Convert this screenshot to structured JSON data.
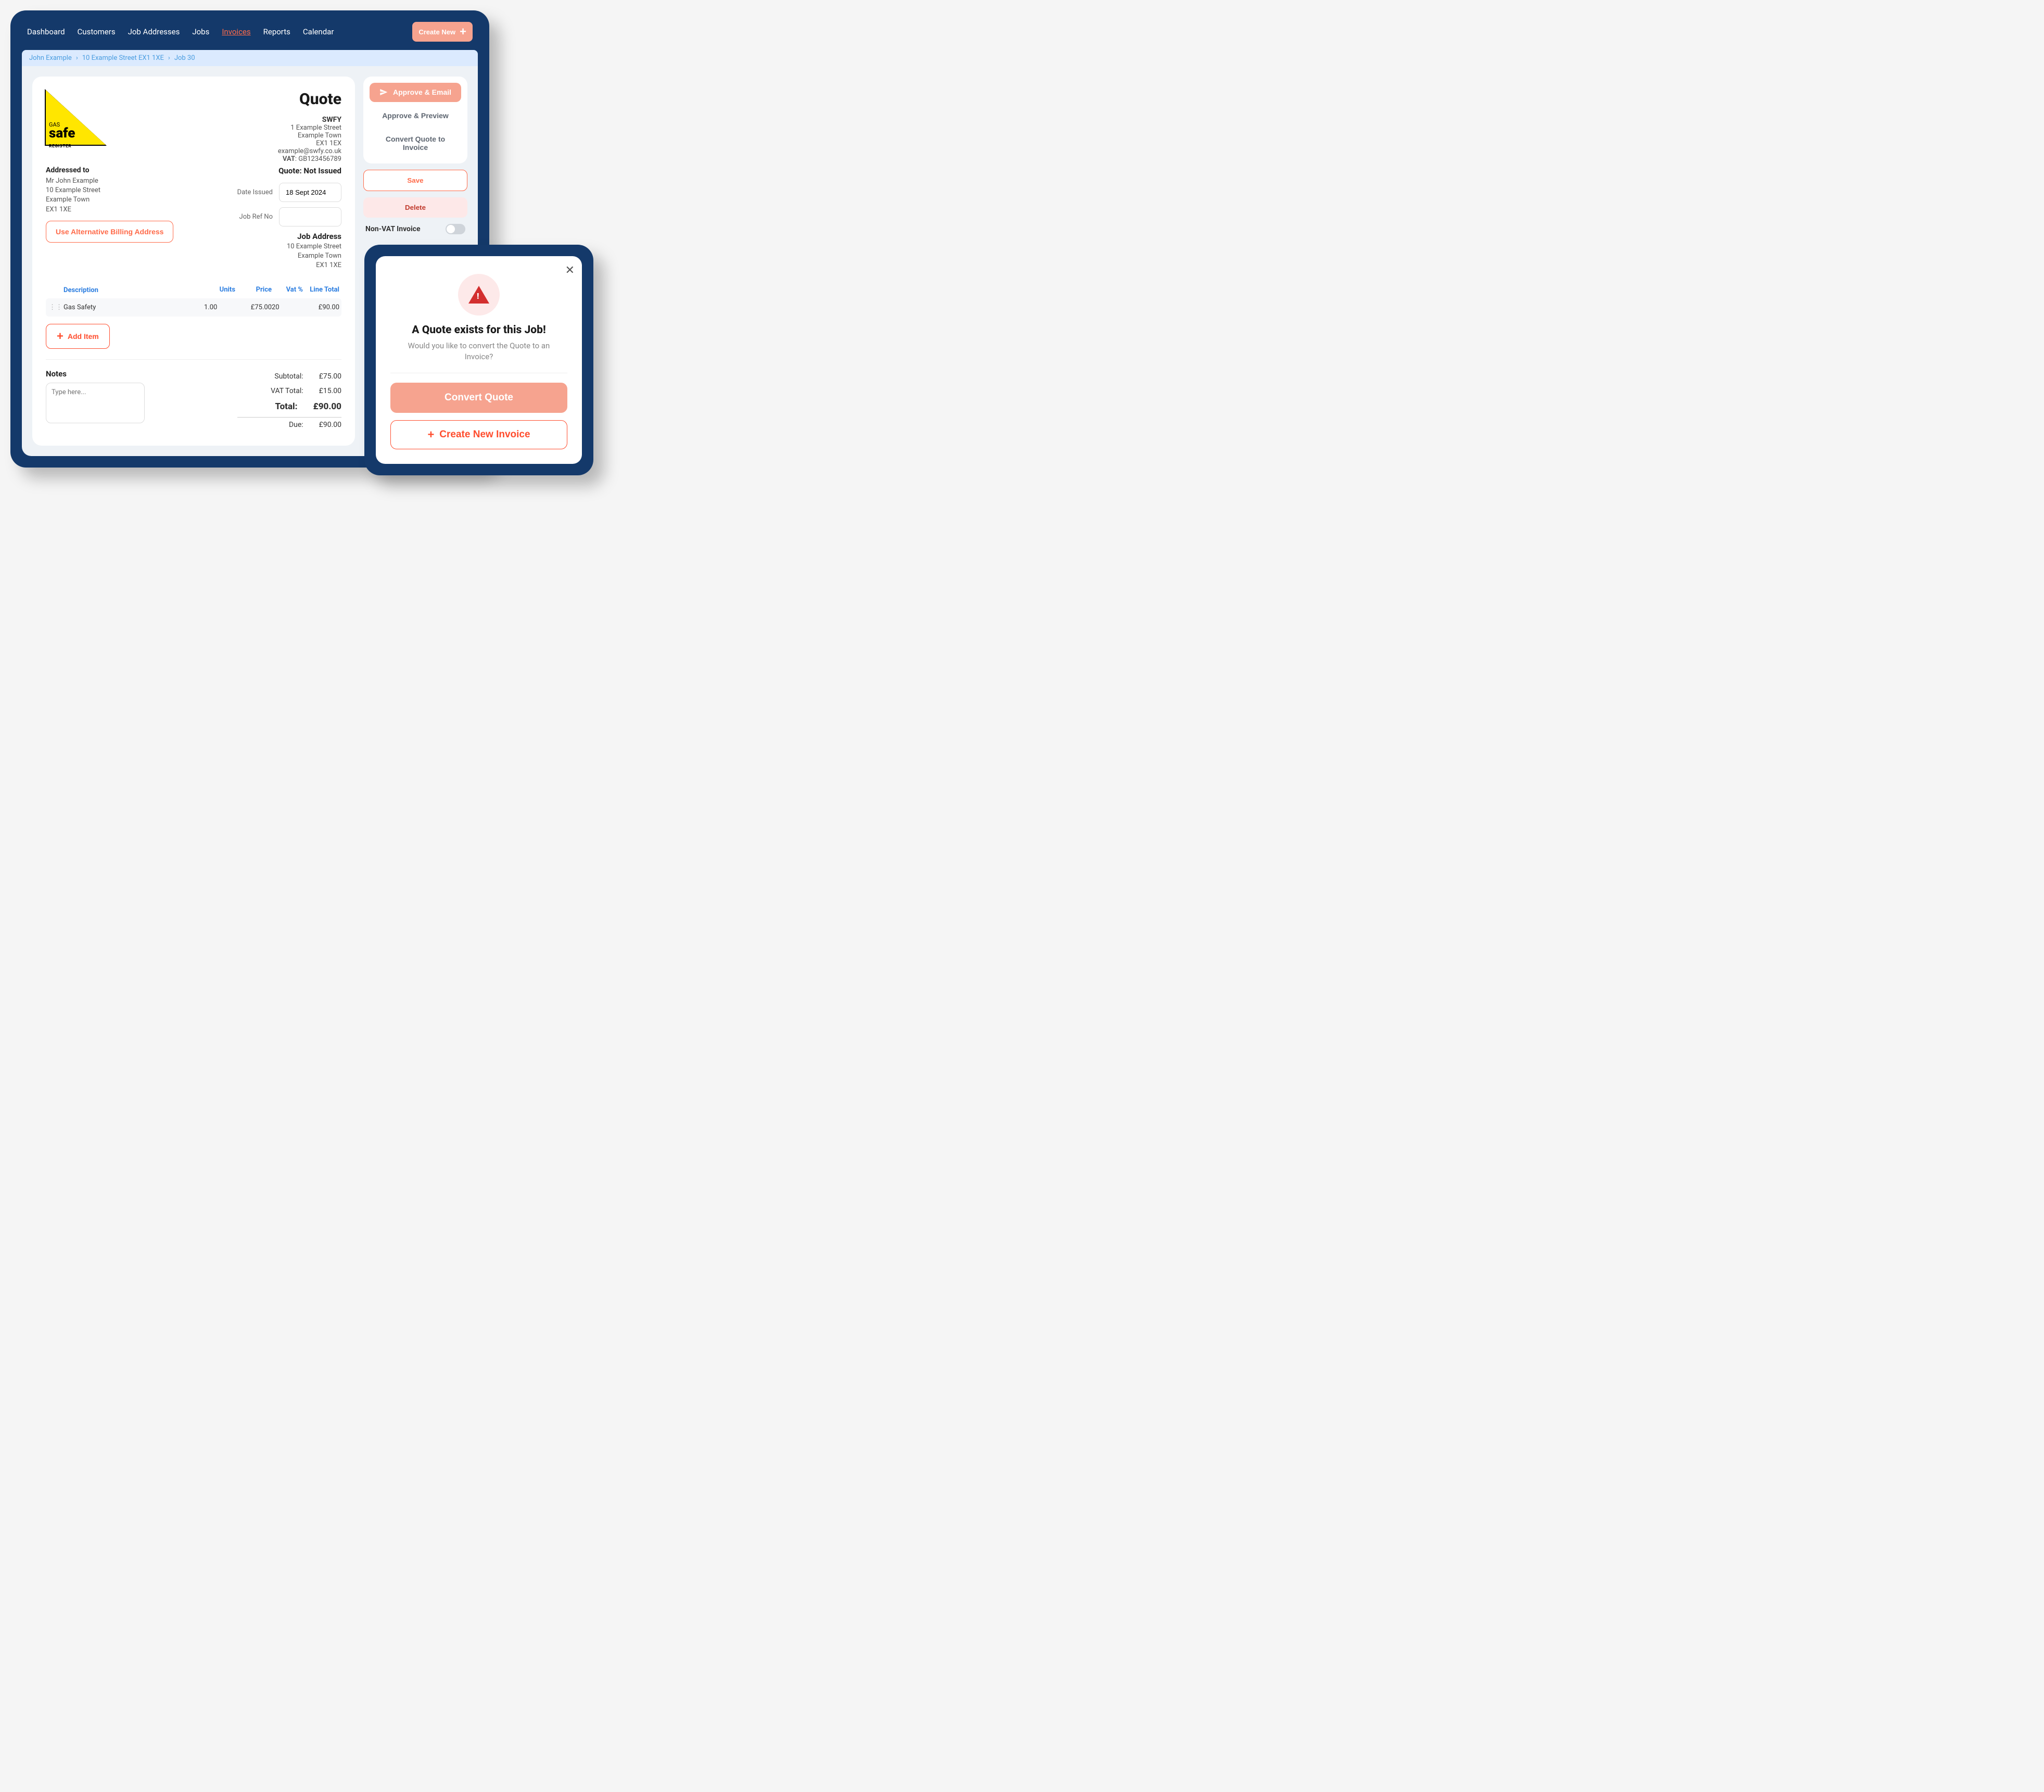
{
  "nav": {
    "items": [
      "Dashboard",
      "Customers",
      "Job Addresses",
      "Jobs",
      "Invoices",
      "Reports",
      "Calendar"
    ],
    "active_index": 4,
    "create_new": "Create New"
  },
  "breadcrumb": {
    "customer": "John Example",
    "address": "10 Example Street EX1 1XE",
    "job": "Job 30"
  },
  "logo": {
    "gas": "GAS",
    "safe": "safe",
    "register": "REGISTER"
  },
  "quote": {
    "title": "Quote",
    "company": {
      "name": "SWFY",
      "line1": "1 Example Street",
      "line2": "Example Town",
      "postcode": "EX1 1EX",
      "email": "example@swfy.co.uk",
      "vat_label": "VAT",
      "vat_value": ": GB123456789"
    },
    "addressed_to_heading": "Addressed to",
    "addressed_to": {
      "name": "Mr John Example",
      "line1": "10 Example Street",
      "line2": "Example Town",
      "postcode": "EX1 1XE"
    },
    "alt_billing_btn": "Use Alternative Billing Address",
    "status": "Quote: Not Issued",
    "date_issued_label": "Date Issued",
    "date_issued_value": "18 Sept 2024",
    "job_ref_label": "Job Ref No",
    "job_ref_value": "",
    "job_address_heading": "Job Address",
    "job_address": {
      "line1": "10 Example Street",
      "line2": "Example Town",
      "postcode": "EX1 1XE"
    }
  },
  "table": {
    "headers": {
      "description": "Description",
      "units": "Units",
      "price": "Price",
      "vat": "Vat %",
      "line_total": "Line Total"
    },
    "rows": [
      {
        "description": "Gas Safety",
        "units": "1.00",
        "price": "£75.00",
        "vat": "20",
        "line_total": "£90.00"
      }
    ],
    "add_item": "Add Item"
  },
  "notes": {
    "heading": "Notes",
    "placeholder": "Type here...",
    "value": ""
  },
  "totals": {
    "subtotal_label": "Subtotal:",
    "subtotal_value": "£75.00",
    "vat_total_label": "VAT Total:",
    "vat_total_value": "£15.00",
    "total_label": "Total:",
    "total_value": "£90.00",
    "due_label": "Due:",
    "due_value": "£90.00"
  },
  "actions": {
    "approve_email": "Approve & Email",
    "approve_preview": "Approve & Preview",
    "convert": "Convert Quote to Invoice",
    "save": "Save",
    "delete": "Delete",
    "nonvat_label": "Non-VAT Invoice"
  },
  "modal": {
    "title": "A Quote exists for this Job!",
    "subtitle": "Would you like to convert the Quote to an Invoice?",
    "primary": "Convert Quote",
    "secondary": "Create New Invoice"
  },
  "colors": {
    "brand_navy": "#14396a",
    "accent_coral": "#f6a38f",
    "accent_red": "#ff4d2e",
    "link_blue": "#2b7de0"
  }
}
